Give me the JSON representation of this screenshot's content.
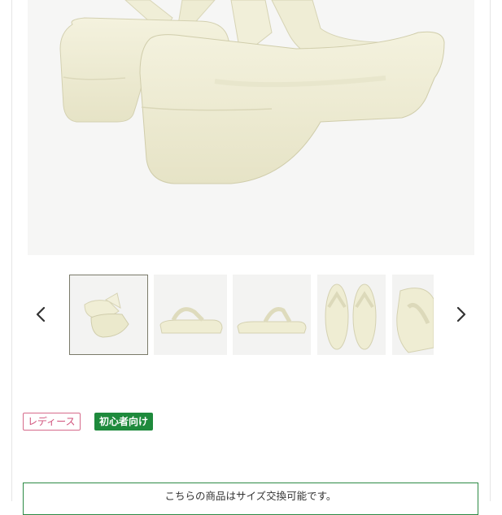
{
  "gallery": {
    "main_image": {
      "alt": "cream platform flip-flop sandals, rear view",
      "color": "#f1efd8"
    },
    "nav_prev_icon": "chevron-left-icon",
    "nav_next_icon": "chevron-right-icon",
    "thumbnails": [
      {
        "view": "pair-rear",
        "selected": true
      },
      {
        "view": "side"
      },
      {
        "view": "side-profile"
      },
      {
        "view": "top-pair"
      },
      {
        "view": "close-up"
      }
    ]
  },
  "tags": {
    "ladies": "レディース",
    "beginner": "初心者向け"
  },
  "notice": {
    "text": "こちらの商品はサイズ交換可能です。"
  },
  "colors": {
    "accent_green": "#1e8a3c",
    "pink": "#d0507a",
    "sandal_cream": "#f1efd8"
  }
}
